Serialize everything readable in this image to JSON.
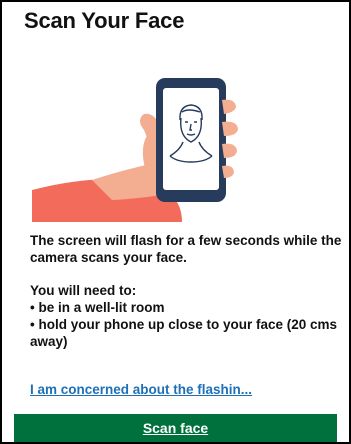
{
  "page": {
    "title": "Scan Your Face"
  },
  "illustration": {
    "icon": "hand-holding-phone-selfie",
    "colors": {
      "sleeve": "#f26b5b",
      "skin": "#f3ae92",
      "phone": "#273b5c",
      "screen": "#ffffff"
    }
  },
  "instructions": {
    "paragraph": "The screen will flash for a few seconds while the camera scans your face.",
    "need_label": "You will need to:",
    "requirements": [
      "• be in a well-lit room",
      "• hold your phone up close to your face (20 cms away)"
    ]
  },
  "link": {
    "label": "I am concerned about the flashin..."
  },
  "primary_action": {
    "label": "Scan face",
    "color": "#00703c"
  }
}
